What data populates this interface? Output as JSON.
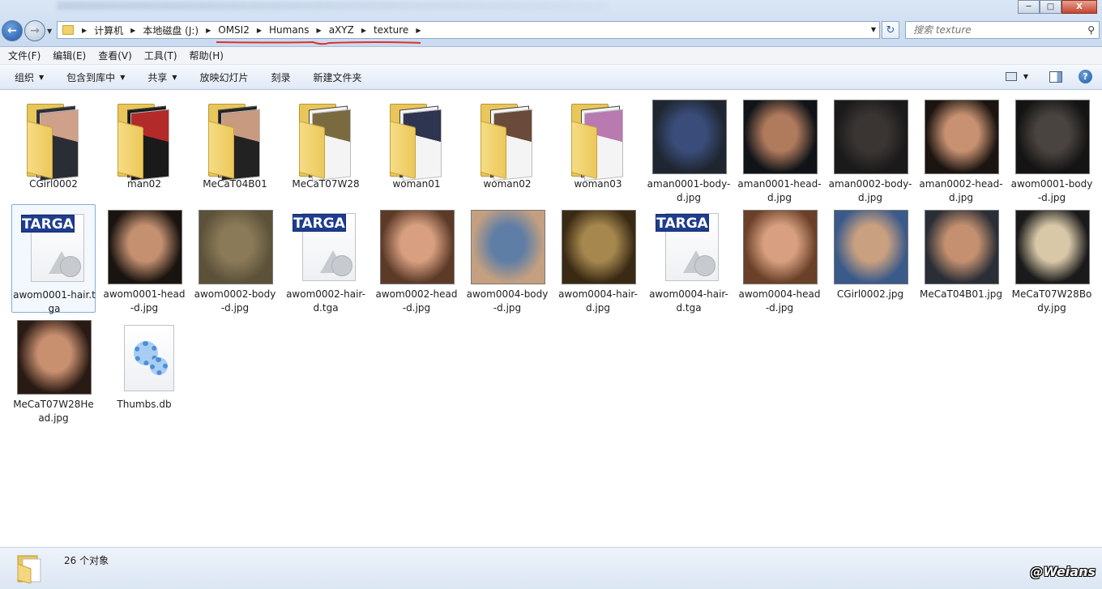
{
  "window": {
    "controls": {
      "minimize": "─",
      "maximize": "□",
      "close": "X"
    }
  },
  "address": {
    "crumbs": [
      "计算机",
      "本地磁盘 (J:)",
      "OMSI2",
      "Humans",
      "aXYZ",
      "texture"
    ]
  },
  "search": {
    "placeholder": "搜索 texture"
  },
  "menu": [
    "文件(F)",
    "编辑(E)",
    "查看(V)",
    "工具(T)",
    "帮助(H)"
  ],
  "toolbar": {
    "organize": "组织",
    "include_library": "包含到库中",
    "share": "共享",
    "slideshow": "放映幻灯片",
    "burn": "刻录",
    "new_folder": "新建文件夹"
  },
  "files": [
    {
      "name": "CGirl0002",
      "type": "folder",
      "colors": [
        "#2a2d33",
        "#cfa08a"
      ]
    },
    {
      "name": "man02",
      "type": "folder",
      "colors": [
        "#1a1a1a",
        "#b22a2a"
      ]
    },
    {
      "name": "MeCaT04B01",
      "type": "folder",
      "colors": [
        "#222",
        "#c89a80"
      ]
    },
    {
      "name": "MeCaT07W28",
      "type": "folder",
      "colors": [
        "#f4f4f4",
        "#7a6a40"
      ]
    },
    {
      "name": "woman01",
      "type": "folder",
      "colors": [
        "#f4f4f4",
        "#2d3550"
      ]
    },
    {
      "name": "woman02",
      "type": "folder",
      "colors": [
        "#f4f4f4",
        "#6a4a3a"
      ]
    },
    {
      "name": "woman03",
      "type": "folder",
      "colors": [
        "#f4f4f4",
        "#b87ab0"
      ]
    },
    {
      "name": "aman0001-body-d.jpg",
      "type": "image",
      "colors": [
        "#1f2630",
        "#3a4d7a"
      ]
    },
    {
      "name": "aman0001-head-d.jpg",
      "type": "image",
      "colors": [
        "#101418",
        "#b07a5c"
      ]
    },
    {
      "name": "aman0002-body-d.jpg",
      "type": "image",
      "colors": [
        "#1a1a1a",
        "#3a3533"
      ]
    },
    {
      "name": "aman0002-head-d.jpg",
      "type": "image",
      "colors": [
        "#1b1410",
        "#c89272"
      ]
    },
    {
      "name": "awom0001-body-d.jpg",
      "type": "image",
      "colors": [
        "#141414",
        "#4a4440"
      ]
    },
    {
      "name": "awom0001-hair.tga",
      "type": "targa"
    },
    {
      "name": "awom0001-head-d.jpg",
      "type": "image",
      "colors": [
        "#1a1410",
        "#c49070"
      ]
    },
    {
      "name": "awom0002-body-d.jpg",
      "type": "image",
      "colors": [
        "#5c523a",
        "#8a7a58"
      ]
    },
    {
      "name": "awom0002-hair-d.tga",
      "type": "targa"
    },
    {
      "name": "awom0002-head-d.jpg",
      "type": "image",
      "colors": [
        "#5c3a28",
        "#d8a080"
      ]
    },
    {
      "name": "awom0004-body-d.jpg",
      "type": "image",
      "colors": [
        "#c4a080",
        "#5f7ea6"
      ]
    },
    {
      "name": "awom0004-hair-d.jpg",
      "type": "image",
      "colors": [
        "#3a2a14",
        "#a6884e"
      ]
    },
    {
      "name": "awom0004-hair-d.tga",
      "type": "targa"
    },
    {
      "name": "awom0004-head-d.jpg",
      "type": "image",
      "colors": [
        "#6a4028",
        "#d8a080"
      ]
    },
    {
      "name": "CGirl0002.jpg",
      "type": "image",
      "colors": [
        "#3a5a8a",
        "#c9a080"
      ]
    },
    {
      "name": "MeCaT04B01.jpg",
      "type": "image",
      "colors": [
        "#2a2e36",
        "#c49070"
      ]
    },
    {
      "name": "MeCaT07W28Body.jpg",
      "type": "image",
      "colors": [
        "#1a1a1a",
        "#d8c8a8"
      ]
    },
    {
      "name": "MeCaT07W28Head.jpg",
      "type": "image",
      "colors": [
        "#2a1a14",
        "#c99070"
      ]
    },
    {
      "name": "Thumbs.db",
      "type": "db"
    }
  ],
  "status": {
    "count": "26 个对象"
  },
  "watermark": "@Weians"
}
